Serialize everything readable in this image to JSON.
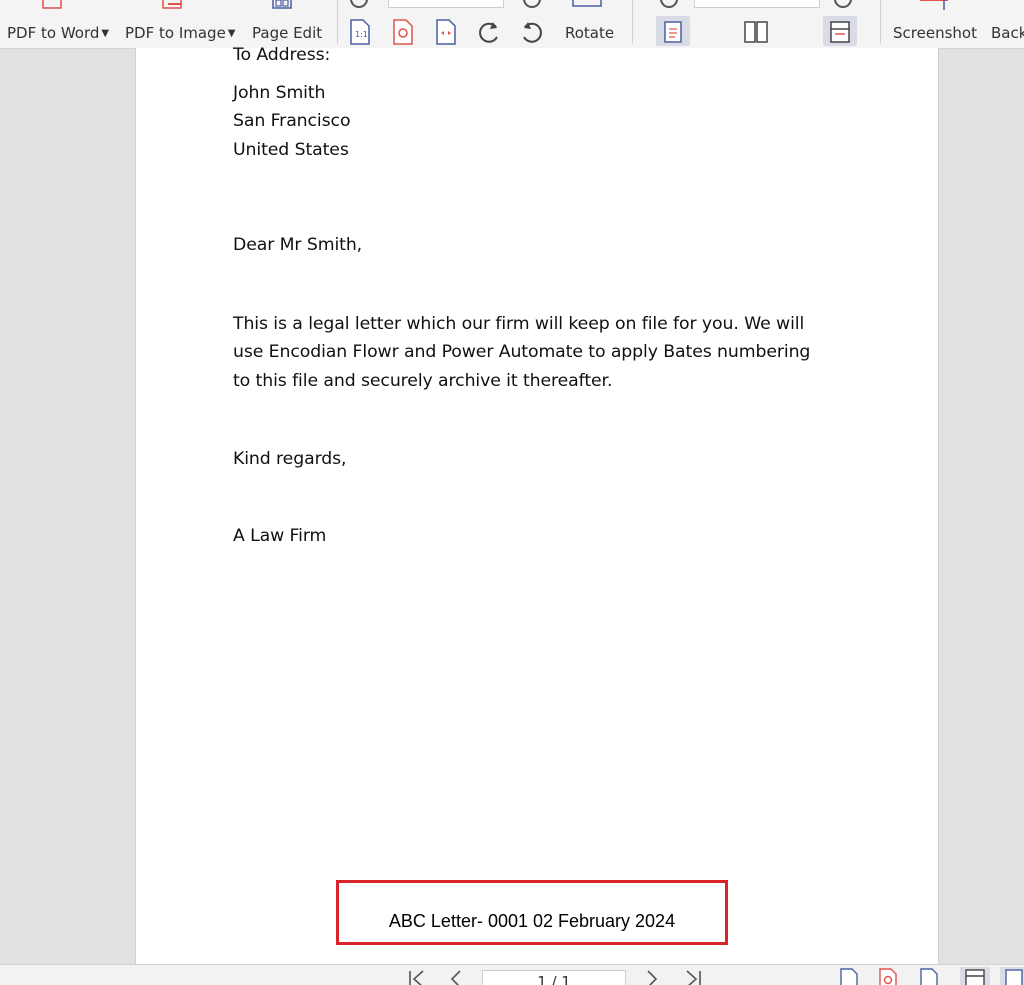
{
  "toolbar": {
    "pdf_to_word": "PDF to Word",
    "pdf_to_image": "PDF to Image",
    "page_edit": "Page Edit",
    "rotate": "Rotate",
    "screenshot": "Screenshot",
    "back": "Back"
  },
  "document": {
    "to_address_label": "To Address:",
    "address": [
      "John Smith",
      "San Francisco",
      "United States"
    ],
    "greeting": "Dear Mr Smith,",
    "body": [
      "This is a legal letter which our firm will keep on file for you. We will",
      "use Encodian Flowr and Power Automate to apply Bates numbering",
      "to this file and securely archive it thereafter."
    ],
    "closing": "Kind regards,",
    "signature": "A Law Firm",
    "footer": "ABC Letter- 0001 02 February 2024"
  },
  "navigation": {
    "page_indicator": "1 / 1"
  },
  "colors": {
    "accent_red": "#d8232a",
    "icon_red": "#e0534a",
    "icon_blue": "#4a5fa0"
  }
}
